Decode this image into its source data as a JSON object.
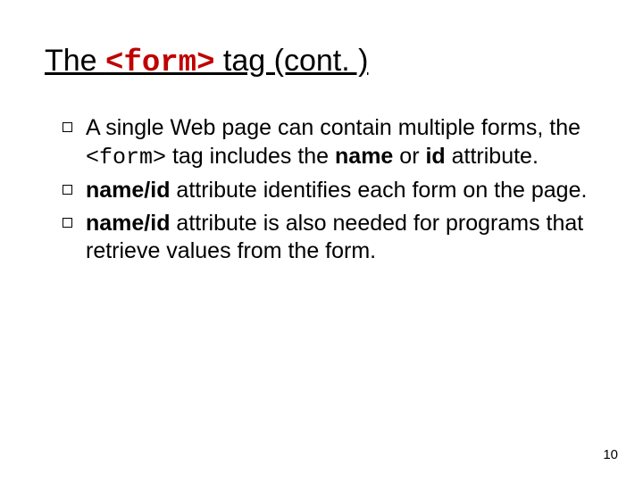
{
  "title": {
    "pre": "The ",
    "code": "<form>",
    "post": " tag (cont. )"
  },
  "bullets": [
    {
      "t1": "A single Web page can contain multiple forms, the ",
      "code": "<form>",
      "t2": " tag includes the ",
      "b1": "name",
      "t3": " or ",
      "b2": "id",
      "t4": " attribute."
    },
    {
      "b1": "name/id",
      "t1": " attribute identifies each form on the page."
    },
    {
      "b1": "name/id",
      "t1": " attribute is also needed for programs that retrieve values from the form."
    }
  ],
  "pageNumber": "10"
}
